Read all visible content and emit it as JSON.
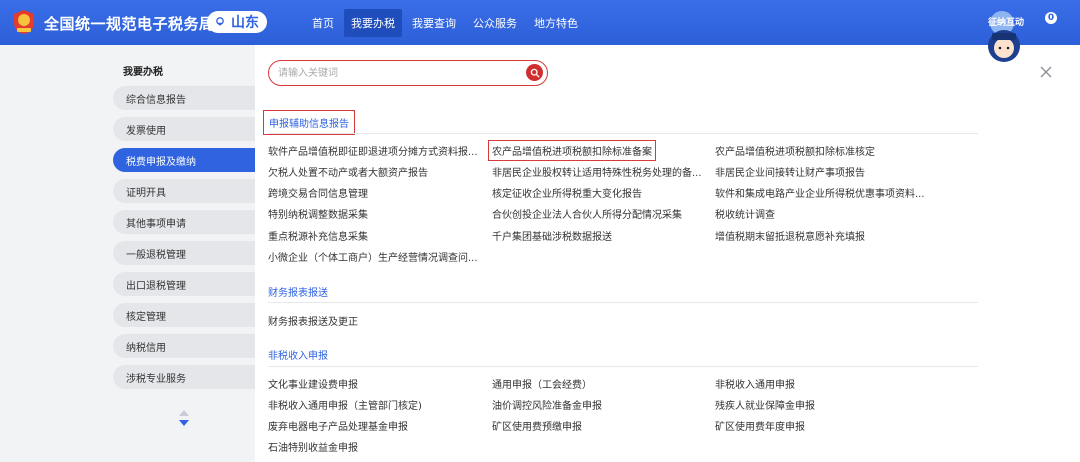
{
  "header": {
    "brand": "全国统一规范电子税务局",
    "region": "山东",
    "nav": [
      "首页",
      "我要办税",
      "我要查询",
      "公众服务",
      "地方特色"
    ],
    "active_nav": "我要办税",
    "assistant_label": "征纳互动",
    "assistant_badge": "0"
  },
  "sidebar": {
    "title": "我要办税",
    "items": [
      "综合信息报告",
      "发票使用",
      "税费申报及缴纳",
      "证明开具",
      "其他事项申请",
      "一般退税管理",
      "出口退税管理",
      "核定管理",
      "纳税信用",
      "涉税专业服务"
    ],
    "active": "税费申报及缴纳"
  },
  "search": {
    "placeholder": "请输入关键词"
  },
  "sections": [
    {
      "title": "申报辅助信息报告",
      "items": [
        [
          "软件产品增值税即征即退进项分摊方式资料报...",
          "农产品增值税进项税额扣除标准备案",
          "农产品增值税进项税额扣除标准核定"
        ],
        [
          "欠税人处置不动产或者大额资产报告",
          "非居民企业股权转让适用特殊性税务处理的备...",
          "非居民企业间接转让财产事项报告"
        ],
        [
          "跨境交易合同信息管理",
          "核定征收企业所得税重大变化报告",
          "软件和集成电路产业企业所得税优惠事项资料..."
        ],
        [
          "特别纳税调整数据采集",
          "合伙创投企业法人合伙人所得分配情况采集",
          "税收统计调查"
        ],
        [
          "重点税源补充信息采集",
          "千户集团基础涉税数据报送",
          "增值税期末留抵退税意愿补充填报"
        ],
        [
          "小微企业（个体工商户）生产经营情况调查问..."
        ]
      ]
    },
    {
      "title": "财务报表报送",
      "items": [
        [
          "财务报表报送及更正"
        ]
      ]
    },
    {
      "title": "非税收入申报",
      "items": [
        [
          "文化事业建设费申报",
          "通用申报（工会经费）",
          "非税收入通用申报"
        ],
        [
          "非税收入通用申报（主管部门核定)",
          "油价调控风险准备金申报",
          "残疾人就业保障金申报"
        ],
        [
          "废弃电器电子产品处理基金申报",
          "矿区使用费预缴申报",
          "矿区使用费年度申报"
        ],
        [
          "石油特别收益金申报"
        ]
      ]
    }
  ],
  "colors": {
    "primary": "#2f63e0",
    "highlight": "#d73a3a"
  }
}
